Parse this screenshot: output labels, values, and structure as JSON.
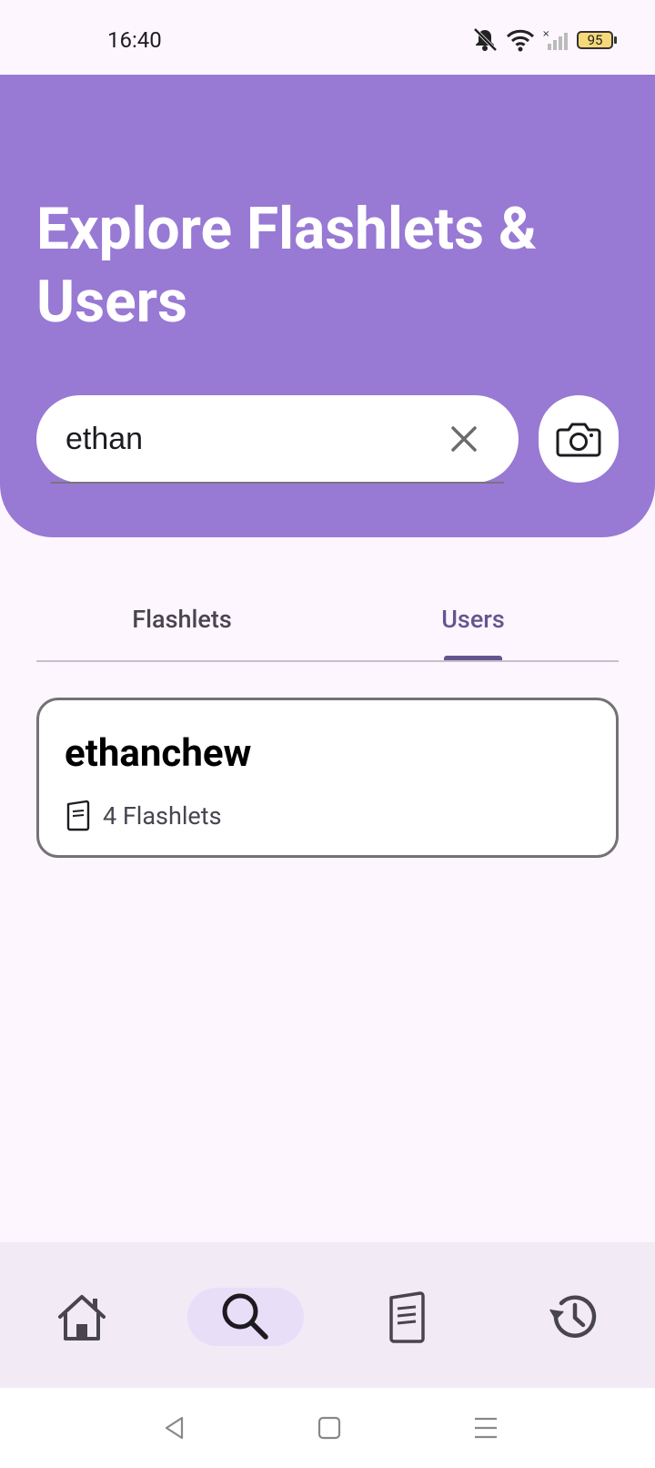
{
  "status_bar": {
    "time": "16:40",
    "battery": "95"
  },
  "header": {
    "title": "Explore Flashlets & Users"
  },
  "search": {
    "value": "ethan"
  },
  "tabs": [
    {
      "label": "Flashlets",
      "selected": false
    },
    {
      "label": "Users",
      "selected": true
    }
  ],
  "results": [
    {
      "username": "ethanchew",
      "flashlet_count": "4 Flashlets"
    }
  ],
  "bottom_nav": {
    "items": [
      {
        "icon": "home-icon",
        "active": false
      },
      {
        "icon": "search-icon",
        "active": true
      },
      {
        "icon": "flashlets-icon",
        "active": false
      },
      {
        "icon": "history-icon",
        "active": false
      }
    ]
  },
  "colors": {
    "header": "#9879d4",
    "accent": "#65558f",
    "background": "#fdf6fe"
  }
}
